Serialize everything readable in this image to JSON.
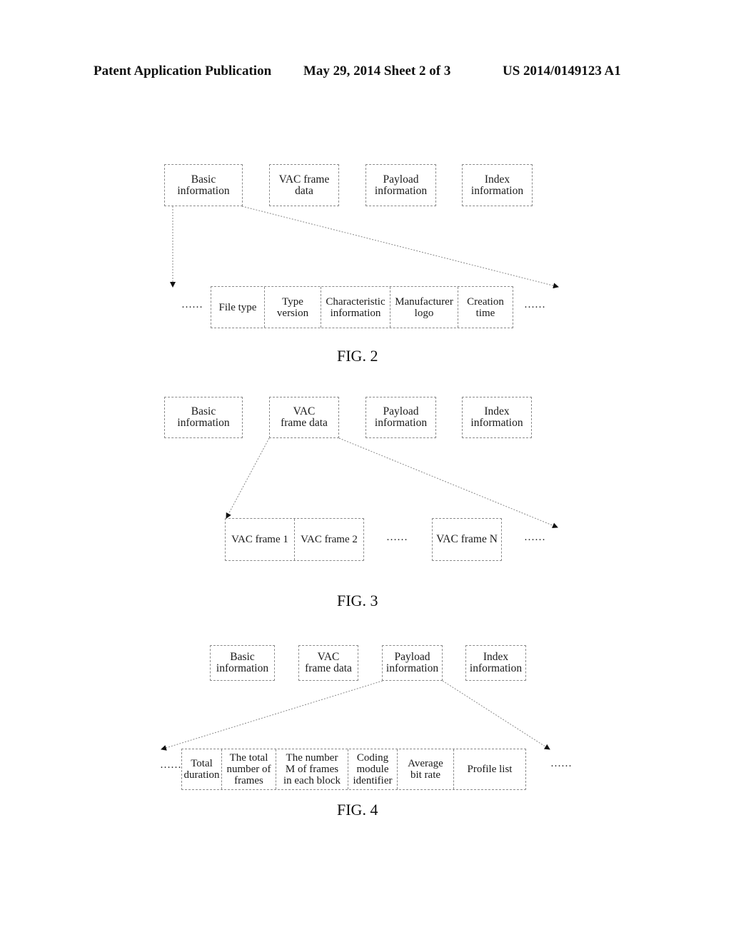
{
  "header": {
    "left": "Patent Application Publication",
    "middle": "May 29, 2014  Sheet 2 of 3",
    "right": "US 2014/0149123 A1"
  },
  "fig2": {
    "top_boxes": [
      "Basic\ninformation",
      "VAC frame\ndata",
      "Payload\ninformation",
      "Index\ninformation"
    ],
    "expanded_from": "Basic information",
    "fields": [
      "File type",
      "Type\nversion",
      "Characteristic\ninformation",
      "Manufacturer\nlogo",
      "Creation\ntime"
    ],
    "ellipsis_left": "……",
    "ellipsis_right": "……",
    "caption": "FIG. 2"
  },
  "fig3": {
    "top_boxes": [
      "Basic\ninformation",
      "VAC\nframe data",
      "Payload\ninformation",
      "Index\ninformation"
    ],
    "expanded_from": "VAC frame data",
    "frames": [
      "VAC frame 1",
      "VAC frame 2",
      "VAC frame N"
    ],
    "ellipsis_middle": "……",
    "ellipsis_right": "……",
    "caption": "FIG. 3"
  },
  "fig4": {
    "top_boxes": [
      "Basic\ninformation",
      "VAC\nframe data",
      "Payload\ninformation",
      "Index\ninformation"
    ],
    "expanded_from": "Payload information",
    "fields": [
      "Total\nduration",
      "The total\nnumber of\nframes",
      "The number\nM of frames\nin each block",
      "Coding\nmodule\nidentifier",
      "Average\nbit rate",
      "Profile list"
    ],
    "ellipsis_left": "……",
    "ellipsis_right": "……",
    "caption": "FIG. 4"
  }
}
